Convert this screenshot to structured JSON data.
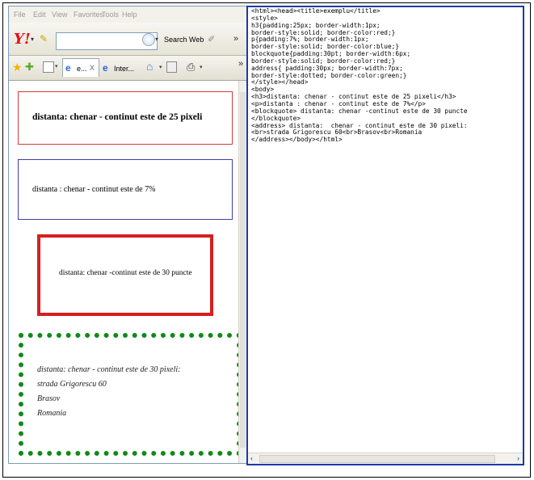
{
  "browser": {
    "menu": [
      "File",
      "Edit",
      "View",
      "Favorites",
      "Tools",
      "Help"
    ],
    "toolbar": {
      "logo_text": "Y!",
      "search_button_label": "Search Web",
      "search_placeholder": ""
    },
    "tabs": [
      {
        "label": "e...",
        "close": "X"
      },
      {
        "label": "Inter..."
      }
    ],
    "icons": {
      "logo": "yahoo-logo-icon",
      "favorites": "star-icon",
      "add_favorites": "add-favorite-icon",
      "quick_tabs": "quick-tabs-icon",
      "home": "home-icon",
      "feeds": "feed-icon",
      "print": "print-icon"
    },
    "page": {
      "h3": "distanta: chenar - continut este de 25 pixeli",
      "p": "distanta : chenar - continut este de 7%",
      "blockquote": "distanta: chenar -continut este de 30 puncte",
      "address": [
        "distanta: chenar - continut este de 30 pixeli:",
        "strada Grigorescu 60",
        "Brasov",
        "Romania"
      ]
    },
    "colors": {
      "h3_border": "#d23a3a",
      "p_border": "#3d3daa",
      "blockquote_border": "#d61f1f",
      "address_border": "#0f8a17"
    }
  },
  "source": {
    "lines": [
      "<html><head><title>exemplu</title>",
      "<style>",
      "h3{padding:25px; border-width:1px;",
      "border-style:solid; border-color:red;}",
      "p{padding:7%; border-width:1px;",
      "border-style:solid; border-color:blue;}",
      "blockquote{padding:30pt; border-width:6px;",
      "border-style:solid; border-color:red;}",
      "address{ padding:30px; border-width:7px;",
      "border-style:dotted; border-color:green;}",
      "</style></head>",
      "<body>",
      "<h3>distanta: chenar - continut este de 25 pixeli</h3>",
      "<p>distanta : chenar - continut este de 7%</p>",
      "<blockquote> distanta: chenar -continut este de 30 puncte",
      "</blockquote>",
      "<address> distanta:  chenar - continut este de 30 pixeli:",
      "<br>strada Grigorescu 60<br>Brasov<br>Romania",
      "</address></body></html>"
    ]
  }
}
